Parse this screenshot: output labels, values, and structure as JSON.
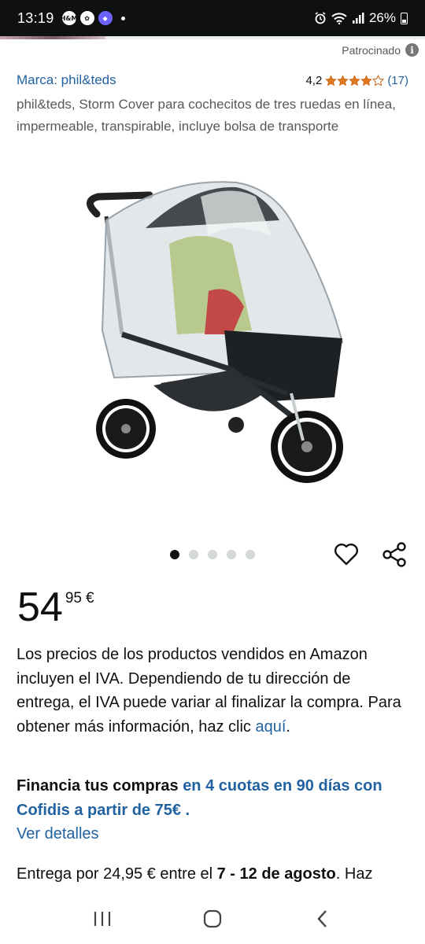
{
  "status_bar": {
    "time": "13:19",
    "badges": [
      "H&M",
      "✿",
      "◆"
    ],
    "battery": "26%"
  },
  "sponsored": {
    "label": "Patrocinado",
    "icon": "info-icon"
  },
  "product": {
    "brand_link": "Marca: phil&teds",
    "rating_value": "4,2",
    "rating_stars": 4.2,
    "rating_count": "(17)",
    "title": "phil&teds, Storm Cover para cochecitos de tres ruedas en línea, impermeable, transpirable, incluye bolsa de transporte"
  },
  "carousel": {
    "dot_count": 5,
    "active_index": 0
  },
  "price": {
    "whole": "54",
    "fraction": "95",
    "currency": "€"
  },
  "tax_note": {
    "text": "Los precios de los productos vendidos en Amazon incluyen el IVA. Dependiendo de tu dirección de entrega, el IVA puede variar al finalizar la compra. Para obtener más información, haz clic ",
    "link": "aquí",
    "end": "."
  },
  "financing": {
    "bold_text": "Financia tus compras",
    "blue_text": "en 4 cuotas en 90 días con Cofidis a partir de 75€",
    "end": " .",
    "details_link": "Ver detalles"
  },
  "delivery": {
    "prefix": "Entrega por 24,95 € entre el ",
    "dates": "7 - 12 de agosto",
    "suffix": ". Haz"
  },
  "colors": {
    "link": "#2162a1",
    "star": "#de7921",
    "text": "#0f1111"
  }
}
